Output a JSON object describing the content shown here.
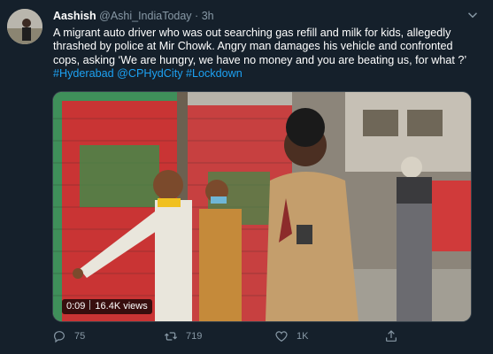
{
  "tweet": {
    "author_name": "Aashish",
    "handle": "@Ashi_IndiaToday",
    "separator": "·",
    "time": "3h",
    "text_plain": "A migrant auto driver who was out searching gas refill and milk for kids, allegedly thrashed by police at Mir Chowk. Angry man damages his vehicle and confronted cops, asking  ‘We are hungry, we have no money and you are beating us, for what ?’ ",
    "hashtags": [
      "#Hyderabad",
      "@CPHydCity",
      "#Lockdown"
    ]
  },
  "video": {
    "duration": "0:09",
    "views": "16.4K views"
  },
  "actions": {
    "reply_count": "75",
    "retweet_count": "719",
    "like_count": "1K"
  },
  "colors": {
    "background": "#15202b",
    "link": "#1da1f2",
    "muted": "#8899a6"
  },
  "icons": {
    "reply": "reply-icon",
    "retweet": "retweet-icon",
    "like": "heart-icon",
    "share": "share-icon",
    "menu": "chevron-down-icon"
  }
}
